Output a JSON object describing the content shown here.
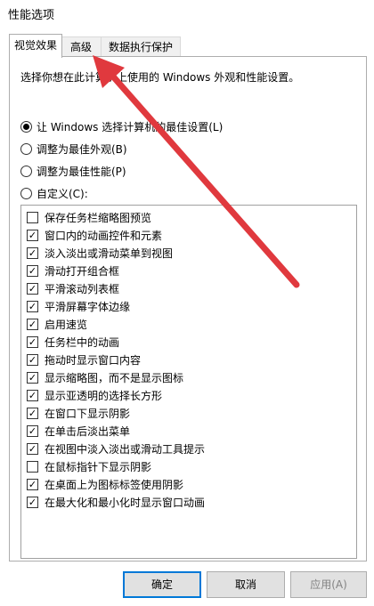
{
  "window": {
    "title": "性能选项"
  },
  "tabs": [
    {
      "label": "视觉效果",
      "active": true
    },
    {
      "label": "高级",
      "active": false
    },
    {
      "label": "数据执行保护",
      "active": false
    }
  ],
  "visual": {
    "description": "选择你想在此计算机上使用的 Windows 外观和性能设置。",
    "radios": [
      {
        "label": "让 Windows 选择计算机的最佳设置(L)",
        "checked": true
      },
      {
        "label": "调整为最佳外观(B)",
        "checked": false
      },
      {
        "label": "调整为最佳性能(P)",
        "checked": false
      },
      {
        "label": "自定义(C):",
        "checked": false
      }
    ],
    "options": [
      {
        "label": "保存任务栏缩略图预览",
        "checked": false
      },
      {
        "label": "窗口内的动画控件和元素",
        "checked": true
      },
      {
        "label": "淡入淡出或滑动菜单到视图",
        "checked": true
      },
      {
        "label": "滑动打开组合框",
        "checked": true
      },
      {
        "label": "平滑滚动列表框",
        "checked": true
      },
      {
        "label": "平滑屏幕字体边缘",
        "checked": true
      },
      {
        "label": "启用速览",
        "checked": true
      },
      {
        "label": "任务栏中的动画",
        "checked": true
      },
      {
        "label": "拖动时显示窗口内容",
        "checked": true
      },
      {
        "label": "显示缩略图，而不是显示图标",
        "checked": true
      },
      {
        "label": "显示亚透明的选择长方形",
        "checked": true
      },
      {
        "label": "在窗口下显示阴影",
        "checked": true
      },
      {
        "label": "在单击后淡出菜单",
        "checked": true
      },
      {
        "label": "在视图中淡入淡出或滑动工具提示",
        "checked": true
      },
      {
        "label": "在鼠标指针下显示阴影",
        "checked": false
      },
      {
        "label": "在桌面上为图标标签使用阴影",
        "checked": true
      },
      {
        "label": "在最大化和最小化时显示窗口动画",
        "checked": true
      }
    ]
  },
  "buttons": {
    "ok": "确定",
    "cancel": "取消",
    "apply": "应用(A)"
  },
  "colors": {
    "accent": "#0078d7",
    "annotation_arrow": "#e0393e"
  }
}
